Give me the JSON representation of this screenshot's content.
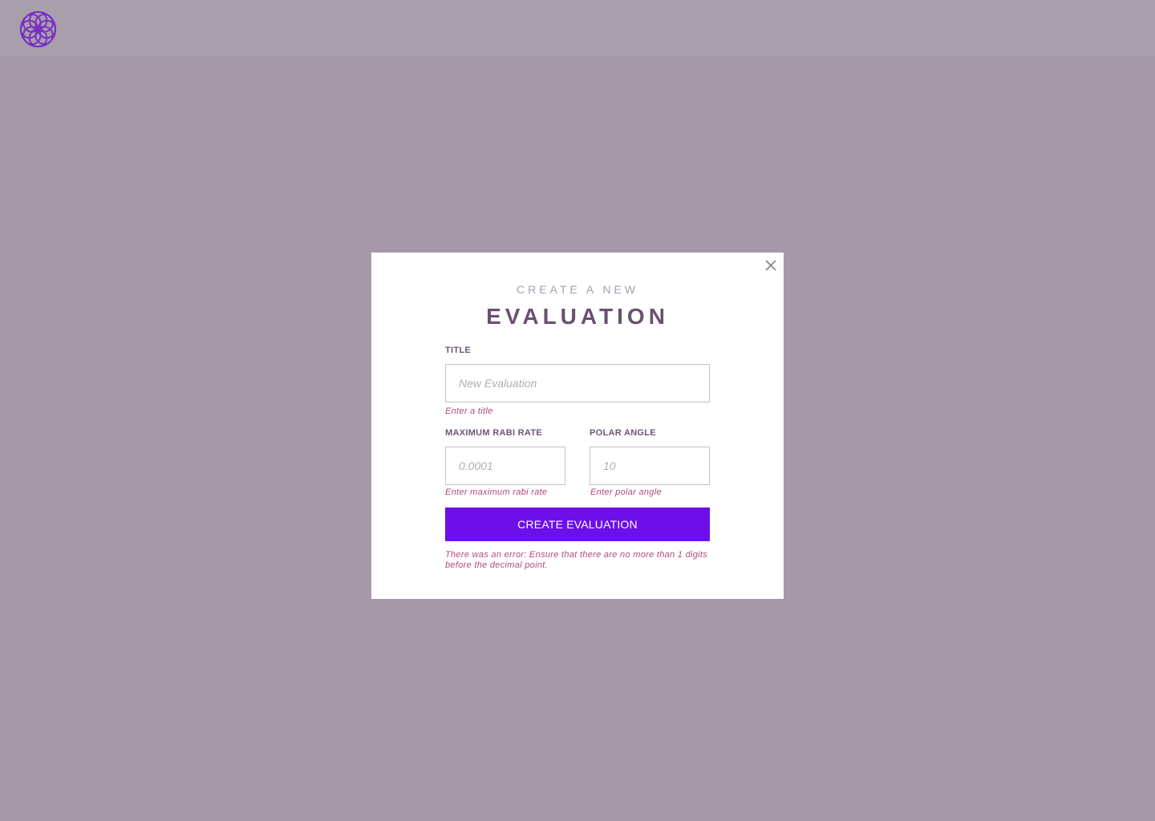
{
  "modal": {
    "subtitle": "CREATE A NEW",
    "title": "EVALUATION",
    "fields": {
      "title": {
        "label": "TITLE",
        "placeholder": "New Evaluation",
        "value": "",
        "hint": "Enter a title"
      },
      "max_rabi_rate": {
        "label": "MAXIMUM RABI RATE",
        "placeholder": "0.0001",
        "value": "",
        "hint": "Enter maximum rabi rate"
      },
      "polar_angle": {
        "label": "POLAR ANGLE",
        "placeholder": "10",
        "value": "",
        "hint": "Enter polar angle"
      }
    },
    "submit_label": "CREATE EVALUATION",
    "error_message": "There was an error: Ensure that there are no more than 1 digits before the decimal point."
  },
  "icons": {
    "logo": "flower-logo-icon",
    "close": "close-icon"
  },
  "colors": {
    "accent": "#6c0fe8",
    "error": "#b04a7c",
    "heading": "#6a5070",
    "backdrop": "#a599a9"
  }
}
